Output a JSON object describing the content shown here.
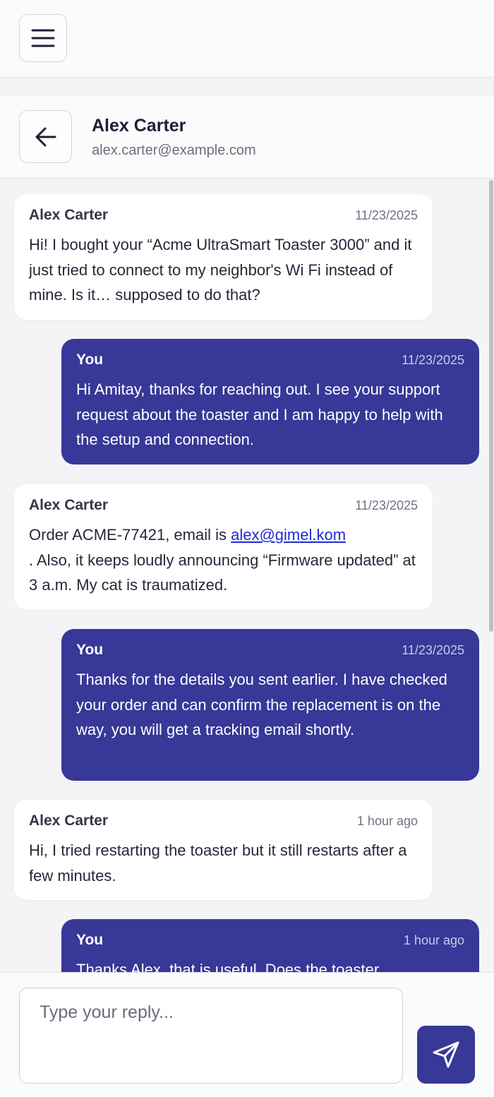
{
  "topbar": {
    "menu_icon": "hamburger-menu-icon"
  },
  "header": {
    "back_icon": "arrow-left-icon",
    "name": "Alex Carter",
    "email": "alex.carter@example.com"
  },
  "messages": [
    {
      "direction": "incoming",
      "sender": "Alex Carter",
      "time": "11/23/2025",
      "text": "Hi! I bought your “Acme UltraSmart Toaster 3000” and it just tried to connect to my neighbor's Wi Fi instead of mine. Is it… supposed to do that?"
    },
    {
      "direction": "outgoing",
      "sender": "You",
      "time": "11/23/2025",
      "text": "Hi Amitay, thanks for reaching out. I see your support request about the toaster and I am happy to help with the setup and connection."
    },
    {
      "direction": "incoming",
      "sender": "Alex Carter",
      "time": "11/23/2025",
      "text_before": "Order ACME-77421, email is ",
      "link": "alex@gimel.kom",
      "text_after": ". Also, it keeps loudly announcing “Firmware updated” at 3 a.m. My cat is traumatized."
    },
    {
      "direction": "outgoing",
      "sender": "You",
      "time": "11/23/2025",
      "text": "Thanks for the details you sent earlier. I have checked your order and can confirm the replacement is on the way, you will get a tracking email shortly."
    },
    {
      "direction": "incoming",
      "sender": "Alex Carter",
      "time": "1 hour ago",
      "text": "Hi, I tried restarting the toaster but it still restarts after a few minutes."
    },
    {
      "direction": "outgoing",
      "sender": "You",
      "time": "1 hour ago",
      "text": "Thanks Alex, that is useful. Does the toaster"
    }
  ],
  "composer": {
    "placeholder": "Type your reply...",
    "value": "",
    "send_icon": "send-paper-plane-icon"
  },
  "colors": {
    "accent": "#373897",
    "incoming_bubble": "#ffffff",
    "link": "#1f2bd6"
  }
}
